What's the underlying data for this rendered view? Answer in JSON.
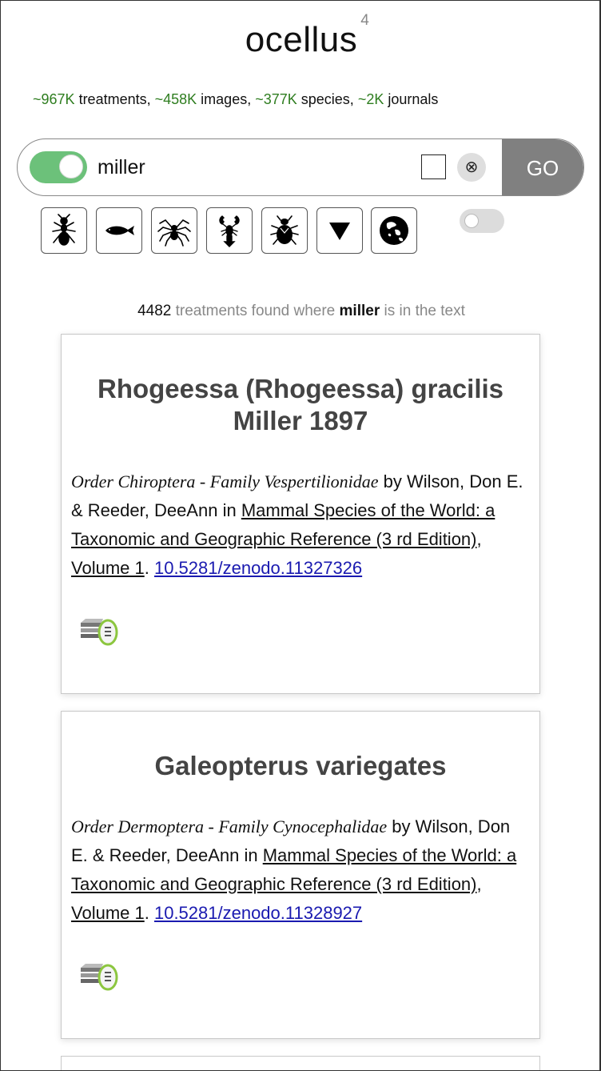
{
  "header": {
    "logo": "ocellus",
    "version": "4"
  },
  "stats": {
    "treatments_num": "~967K",
    "treatments_label": " treatments, ",
    "images_num": "~458K",
    "images_label": " images, ",
    "species_num": "~377K",
    "species_label": " species, ",
    "journals_num": "~2K",
    "journals_label": " journals"
  },
  "search": {
    "query": "miller",
    "clear_symbol": "⊗",
    "go_label": "GO",
    "toggle_on": true,
    "checkbox_checked": false
  },
  "filters": [
    {
      "icon": "ant-icon"
    },
    {
      "icon": "fish-icon"
    },
    {
      "icon": "spider-icon"
    },
    {
      "icon": "lobster-icon"
    },
    {
      "icon": "beetle-icon"
    },
    {
      "icon": "dropdown-triangle-icon"
    },
    {
      "icon": "globe-icon"
    }
  ],
  "results": {
    "count": "4482",
    "text_before": " treatments found where ",
    "query": "miller",
    "text_after": " is in the text"
  },
  "cards": [
    {
      "title_line1": "Rhogeessa (Rhogeessa) gracilis",
      "title_line2": "Miller 1897",
      "taxon": "Order Chiroptera - Family Vespertilionidae",
      "authors": " by Wilson, Don E. & Reeder, DeeAnn in ",
      "journal": "Mammal Species of the World: a Taxonomic and Geographic Reference (3 rd Edition)",
      "sep": ",",
      "volume": " Volume 1",
      "period": ". ",
      "doi": "10.5281/zenodo.11327326"
    },
    {
      "title_line1": "Galeopterus variegates",
      "taxon": "Order Dermoptera - Family Cynocephalidae",
      "authors": " by Wilson, Don E. & Reeder, DeeAnn in ",
      "journal": "Mammal Species of the World: a Taxonomic and Geographic Reference (3 rd Edition)",
      "sep": ",",
      "volume": " Volume 1",
      "period": ". ",
      "doi": "10.5281/zenodo.11328927"
    }
  ],
  "colors": {
    "stat_green": "#2e7d1f",
    "toggle_green": "#6cc17a",
    "go_gray": "#808080",
    "doi_blue": "#1a1ab0"
  }
}
